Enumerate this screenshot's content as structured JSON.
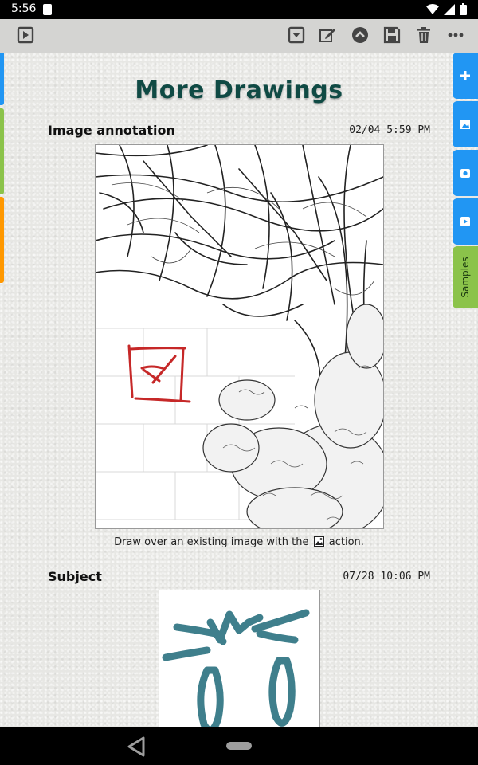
{
  "status_bar": {
    "time": "5:56"
  },
  "title": "More Drawings",
  "notes": [
    {
      "name": "Image annotation",
      "stamp": "02/04  5:59 PM",
      "caption_before": "Draw over an existing image with the",
      "caption_after": "action."
    },
    {
      "name": "Subject",
      "stamp": "07/28 10:06 PM"
    }
  ],
  "side_tabs": {
    "samples_label": "Samples"
  },
  "colors": {
    "title": "#0f4a44",
    "tab_blue": "#2196f3",
    "tab_green": "#8bc34a",
    "tab_orange": "#ff9800",
    "ink_red": "#c62828",
    "ink_teal": "#3f7f8c"
  }
}
